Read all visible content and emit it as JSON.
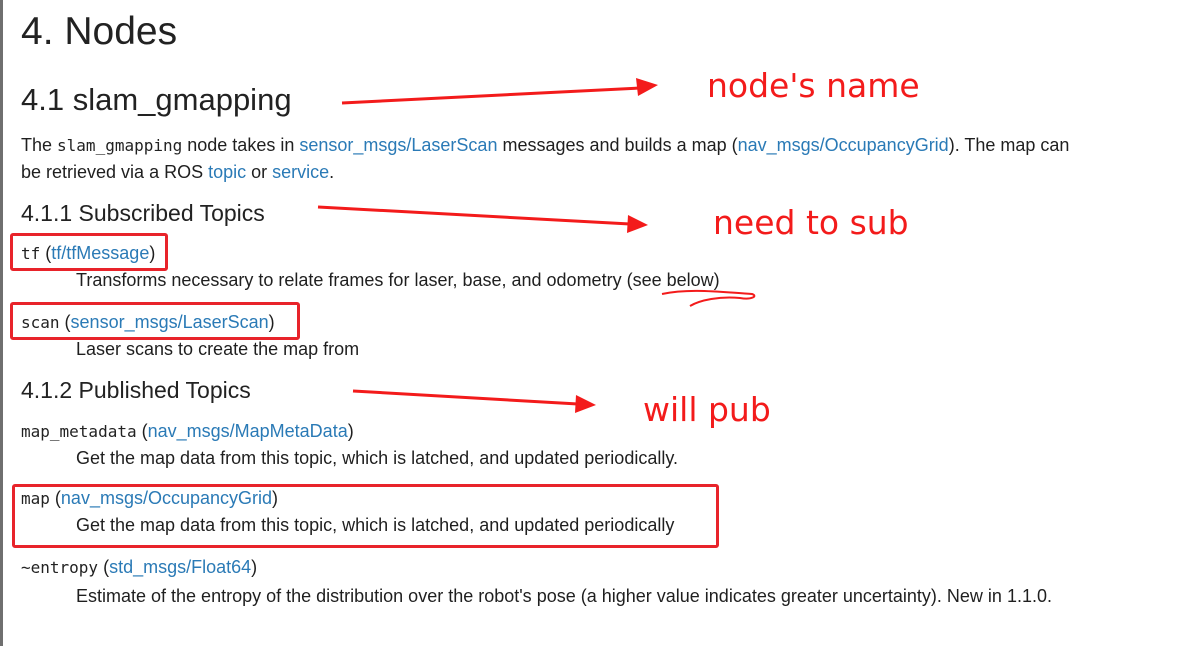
{
  "page": {
    "h1": "4. Nodes",
    "h2": "4.1 slam_gmapping",
    "intro": {
      "t1": "The ",
      "code": "slam_gmapping",
      "t2": " node takes in ",
      "link1": "sensor_msgs/LaserScan",
      "t3": " messages and builds a map (",
      "link2": "nav_msgs/OccupancyGrid",
      "t4": "). The map can be retrieved via a ROS ",
      "link3": "topic",
      "t5": " or ",
      "link4": "service",
      "t6": "."
    },
    "subscribed": {
      "heading": "4.1.1 Subscribed Topics",
      "items": [
        {
          "name": "tf",
          "type": "tf/tfMessage",
          "desc": "Transforms necessary to relate frames for laser, base, and odometry (",
          "desc_link": "see below",
          "desc_end": ")"
        },
        {
          "name": "scan",
          "type": "sensor_msgs/LaserScan",
          "desc": "Laser scans to create the map from"
        }
      ]
    },
    "published": {
      "heading": "4.1.2 Published Topics",
      "items": [
        {
          "name": "map_metadata",
          "type": "nav_msgs/MapMetaData",
          "desc": "Get the map data from this topic, which is latched, and updated periodically."
        },
        {
          "name": "map",
          "type": "nav_msgs/OccupancyGrid",
          "desc": "Get the map data from this topic, which is latched, and updated periodically"
        },
        {
          "name": "~entropy",
          "type": "std_msgs/Float64",
          "desc": "Estimate of the entropy of the distribution over the robot's pose (a higher value indicates greater uncertainty). New in 1.1.0."
        }
      ]
    }
  },
  "annotations": {
    "node_name": "node's name",
    "need_sub": "need to sub",
    "will_pub": "will pub",
    "color": "#f31b1b"
  }
}
